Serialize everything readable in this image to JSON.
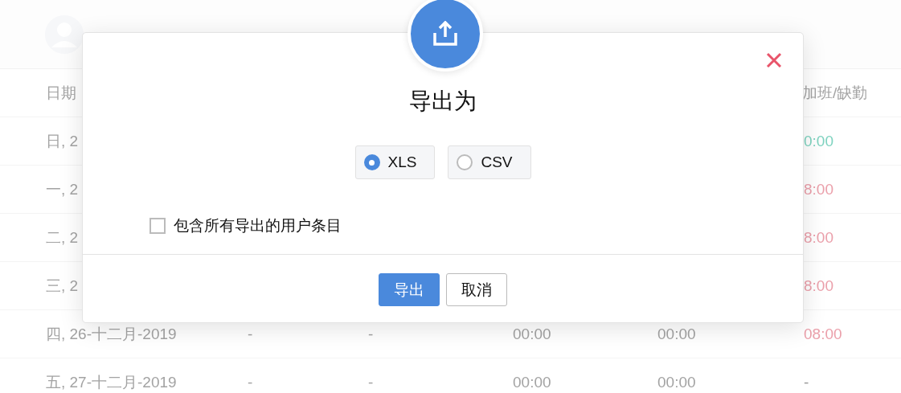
{
  "table": {
    "columns": [
      "日期",
      "",
      "",
      "",
      "",
      "加班/缺勤"
    ],
    "rows": [
      {
        "cells": [
          "日, 2",
          "",
          "",
          "",
          "",
          "0:00"
        ],
        "color": "#7fd3c0"
      },
      {
        "cells": [
          "一, 2",
          "",
          "",
          "",
          "",
          "8:00"
        ],
        "color": "#eba0ab"
      },
      {
        "cells": [
          "二, 2",
          "",
          "",
          "",
          "",
          "8:00"
        ],
        "color": "#eba0ab"
      },
      {
        "cells": [
          "三, 2",
          "",
          "",
          "",
          "",
          "8:00"
        ],
        "color": "#eba0ab"
      },
      {
        "cells": [
          "四, 26-十二月-2019",
          "-",
          "-",
          "00:00",
          "00:00",
          "08:00"
        ],
        "color": "#eba0ab"
      },
      {
        "cells": [
          "五, 27-十二月-2019",
          "-",
          "-",
          "00:00",
          "00:00",
          "-"
        ],
        "color": "#999999"
      }
    ]
  },
  "dialog": {
    "title": "导出为",
    "formats": [
      {
        "label": "XLS",
        "selected": true
      },
      {
        "label": "CSV",
        "selected": false
      }
    ],
    "include_all": {
      "label": "包含所有导出的用户条目",
      "checked": false
    },
    "buttons": [
      {
        "label": "导出",
        "kind": "primary"
      },
      {
        "label": "取消",
        "kind": "secondary"
      }
    ]
  }
}
